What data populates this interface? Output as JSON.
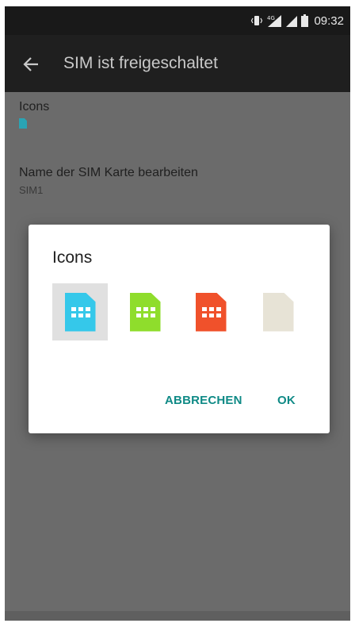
{
  "status_bar": {
    "time": "09:32",
    "network_type": "4G",
    "icons": [
      "vibrate-icon",
      "signal-4g-icon",
      "signal-icon",
      "battery-icon"
    ]
  },
  "app_bar": {
    "title": "SIM ist freigeschaltet",
    "back_icon": "back-arrow-icon"
  },
  "preferences": {
    "icons": {
      "title": "Icons",
      "color": "#2aa4b4"
    },
    "name": {
      "title": "Name der SIM Karte bearbeiten",
      "value": "SIM1"
    }
  },
  "dialog": {
    "title": "Icons",
    "options": [
      {
        "name": "sim-cyan",
        "color": "#35c8ea",
        "selected": true
      },
      {
        "name": "sim-green",
        "color": "#8fdd2c",
        "selected": false
      },
      {
        "name": "sim-red",
        "color": "#f0512b",
        "selected": false
      },
      {
        "name": "sim-beige",
        "color": "#e7e3d6",
        "selected": false
      }
    ],
    "cancel_label": "ABBRECHEN",
    "ok_label": "OK"
  },
  "colors": {
    "accent": "#0f8a86",
    "app_bar": "#1f1f1f",
    "scrim": "#6b6b6b"
  }
}
